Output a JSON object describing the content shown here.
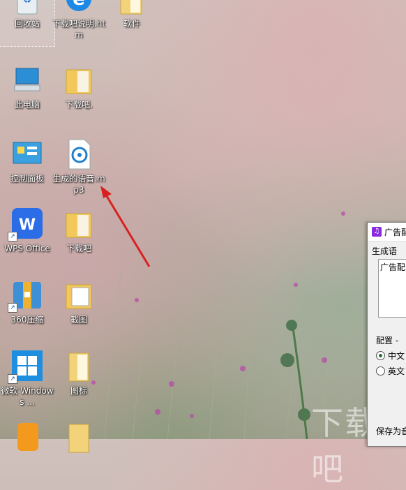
{
  "desktop": {
    "icons": [
      {
        "name": "recycle-bin",
        "label": "回收站"
      },
      {
        "name": "ie-htm-file",
        "label": "下载吧说明.htm"
      },
      {
        "name": "software-folder",
        "label": "软件"
      },
      {
        "name": "this-pc",
        "label": "此电脑"
      },
      {
        "name": "xiazaiba-folder-1",
        "label": "下载吧."
      },
      {
        "name": "control-panel",
        "label": "控制面板"
      },
      {
        "name": "mp3-file",
        "label": "生成的语音.mp3"
      },
      {
        "name": "wps-office",
        "label": "WPS Office"
      },
      {
        "name": "xiazaiba-folder-2",
        "label": "下载吧"
      },
      {
        "name": "360zip",
        "label": "360压缩"
      },
      {
        "name": "screenshot-folder",
        "label": "截图"
      },
      {
        "name": "microsoft-windows",
        "label": "微软 Windows ..."
      },
      {
        "name": "icons-folder",
        "label": "图标"
      }
    ]
  },
  "app_window": {
    "title": "广告配",
    "group_generate": "生成语",
    "textbox_text": "广告配",
    "group_config": "配置 -",
    "radio_chinese": "中文",
    "radio_english": "英文",
    "save_as": "保存为音",
    "selected_language": "中文"
  },
  "watermark": "下载吧",
  "colors": {
    "window_title_icon": "#8a2be2",
    "arrow": "#d82020"
  }
}
